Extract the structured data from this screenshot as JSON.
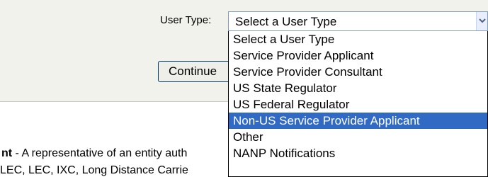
{
  "form": {
    "user_type_label": "User Type:",
    "selected_value": "Select a User Type",
    "continue_label": "Continue"
  },
  "dropdown": {
    "options": [
      "Select a User Type",
      "Service Provider Applicant",
      "Service Provider Consultant",
      "US State Regulator",
      "US Federal Regulator",
      "Non-US Service Provider Applicant",
      "Other",
      "NANP Notifications"
    ],
    "highlighted_option": "Non-US Service Provider Applicant"
  },
  "description": {
    "line1_bold": "nt",
    "line1_text": " - A representative of an entity auth",
    "line2_text": "LEC, LEC, IXC, Long Distance Carrie"
  },
  "colors": {
    "panel_background": "#f2f2ec",
    "highlight": "#316ac5",
    "select_border": "#7f9db9"
  }
}
